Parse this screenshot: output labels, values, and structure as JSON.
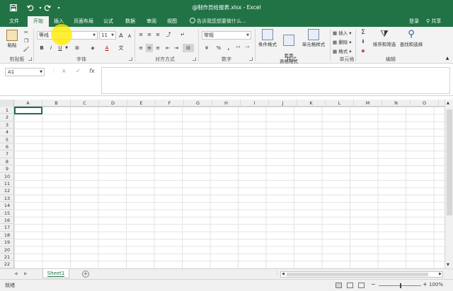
{
  "window": {
    "title": "@制作员给报表.xlsx - Excel"
  },
  "quick_access": {
    "save_icon": "save-icon",
    "undo_icon": "undo-icon",
    "redo_icon": "redo-icon"
  },
  "tabs": [
    {
      "label": "文件",
      "active": false
    },
    {
      "label": "开始",
      "active": true
    },
    {
      "label": "插入",
      "active": false
    },
    {
      "label": "页面布局",
      "active": false
    },
    {
      "label": "公式",
      "active": false
    },
    {
      "label": "数据",
      "active": false
    },
    {
      "label": "审阅",
      "active": false
    },
    {
      "label": "视图",
      "active": false
    }
  ],
  "tell_me": {
    "placeholder": "告诉我您想要做什么..."
  },
  "account": {
    "login": "登录",
    "share": "共享"
  },
  "ribbon": {
    "clipboard": {
      "paste": "粘贴",
      "label": "剪贴板"
    },
    "font": {
      "family": "等线",
      "size": "11",
      "bold": "B",
      "italic": "I",
      "underline": "U",
      "grow": "A",
      "shrink": "A",
      "label": "字体"
    },
    "alignment": {
      "label": "对齐方式"
    },
    "number": {
      "format": "常规",
      "percent": "%",
      "comma": ",",
      "label": "数字"
    },
    "styles": {
      "conditional": "条件格式",
      "table_format": "套用\n表格格式",
      "cell_styles": "单元格样式",
      "label": "样式"
    },
    "cells": {
      "insert": "插入",
      "delete": "删除",
      "format": "格式",
      "label": "单元格"
    },
    "editing": {
      "sort_filter": "排序和筛选",
      "find_select": "查找和选择",
      "label": "编辑"
    }
  },
  "formula_bar": {
    "name_box": "A1",
    "cancel": "×",
    "enter": "✓",
    "fx": "fx",
    "value": ""
  },
  "columns": [
    "A",
    "B",
    "C",
    "D",
    "E",
    "F",
    "G",
    "H",
    "I",
    "J",
    "K",
    "L",
    "M",
    "N",
    "O"
  ],
  "rows": [
    "1",
    "2",
    "3",
    "4",
    "5",
    "6",
    "7",
    "8",
    "9",
    "10",
    "11",
    "12",
    "13",
    "14",
    "15",
    "16",
    "17",
    "18",
    "19",
    "20",
    "21",
    "22"
  ],
  "sheets": [
    {
      "name": "Sheet1",
      "active": true
    }
  ],
  "status": {
    "ready": "就绪",
    "zoom": "100%"
  },
  "colors": {
    "accent": "#217346",
    "ribbon_bg": "#f3f3f3",
    "highlight": "#ffeb00"
  }
}
